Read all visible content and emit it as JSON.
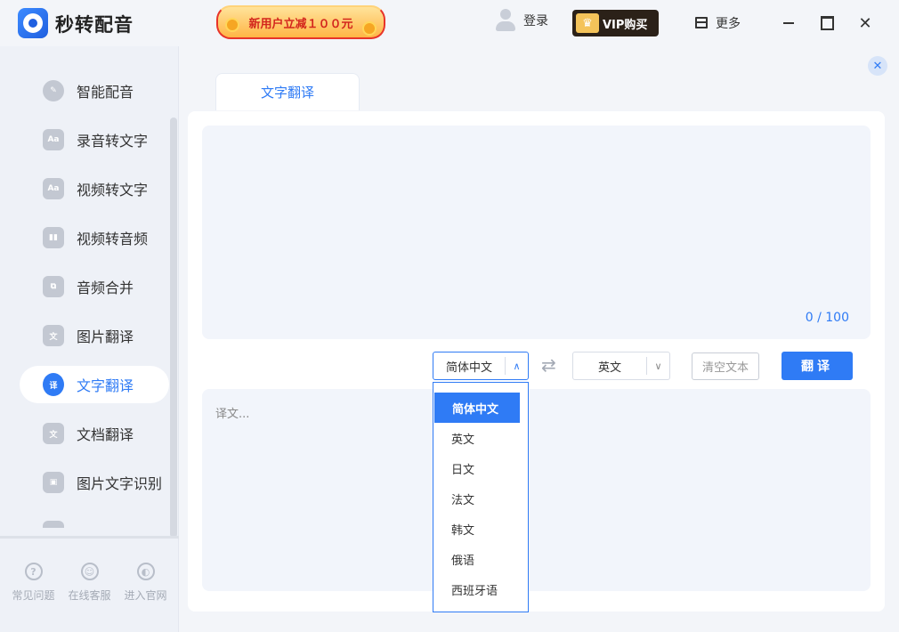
{
  "app": {
    "name": "秒转配音"
  },
  "header": {
    "promo_text": "新用户立减１００元",
    "login_label": "登录",
    "vip_label": "VIP购买",
    "more_label": "更多"
  },
  "sidebar": {
    "items": [
      {
        "label": "智能配音",
        "icon": "voice-icon"
      },
      {
        "label": "录音转文字",
        "icon": "recording-to-text-icon"
      },
      {
        "label": "视频转文字",
        "icon": "video-to-text-icon"
      },
      {
        "label": "视频转音频",
        "icon": "video-to-audio-icon"
      },
      {
        "label": "音频合并",
        "icon": "audio-merge-icon"
      },
      {
        "label": "图片翻译",
        "icon": "image-translate-icon"
      },
      {
        "label": "文字翻译",
        "icon": "text-translate-icon",
        "active": true
      },
      {
        "label": "文档翻译",
        "icon": "document-translate-icon"
      },
      {
        "label": "图片文字识别",
        "icon": "ocr-icon"
      },
      {
        "label": "",
        "icon": "partial-item-icon"
      }
    ],
    "footer": [
      {
        "label": "常见问题",
        "icon": "faq-icon"
      },
      {
        "label": "在线客服",
        "icon": "support-icon"
      },
      {
        "label": "进入官网",
        "icon": "website-icon"
      }
    ]
  },
  "main": {
    "tab_label": "文字翻译",
    "char_count": "0 / 100",
    "source_lang": "简体中文",
    "target_lang": "英文",
    "clear_label": "清空文本",
    "translate_label": "翻译",
    "result_placeholder": "译文..."
  },
  "dropdown": {
    "options": [
      "简体中文",
      "英文",
      "日文",
      "法文",
      "韩文",
      "俄语",
      "西班牙语"
    ],
    "selected": "简体中文"
  },
  "colors": {
    "accent": "#2f7bf5",
    "background": "#f3f5f9",
    "vip_bg": "#2b2118"
  }
}
